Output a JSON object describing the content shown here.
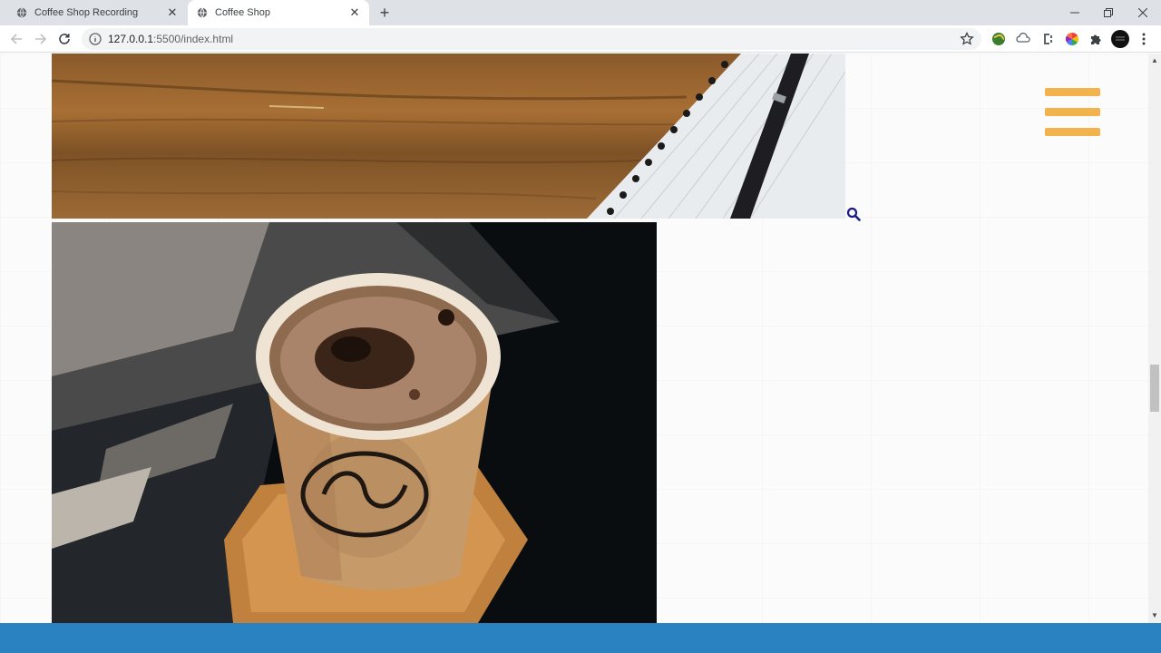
{
  "browser": {
    "tabs": [
      {
        "title": "Coffee Shop Recording",
        "active": false
      },
      {
        "title": "Coffee Shop",
        "active": true
      }
    ],
    "new_tab_icon": "plus-icon",
    "address": {
      "host": "127.0.0.1",
      "path": ":5500/index.html"
    },
    "window_controls": [
      "minimize-icon",
      "restore-icon",
      "close-icon"
    ],
    "extensions": [
      "globe-extension-icon",
      "cloud-extension-icon",
      "c-extension-icon",
      "color-wheel-extension-icon",
      "puzzle-icon",
      "profile-avatar",
      "menu-dots-icon"
    ]
  },
  "page": {
    "images": [
      "wooden-desk-with-notebook-and-pen",
      "paper-coffee-cup-on-wooden-coaster"
    ],
    "menu_icon": "hamburger-menu-icon",
    "search_icon": "search-icon"
  },
  "colors": {
    "hamburger": "#f2b24c",
    "search_icon": "#1a1a8c",
    "taskbar": "#2b82c0"
  }
}
